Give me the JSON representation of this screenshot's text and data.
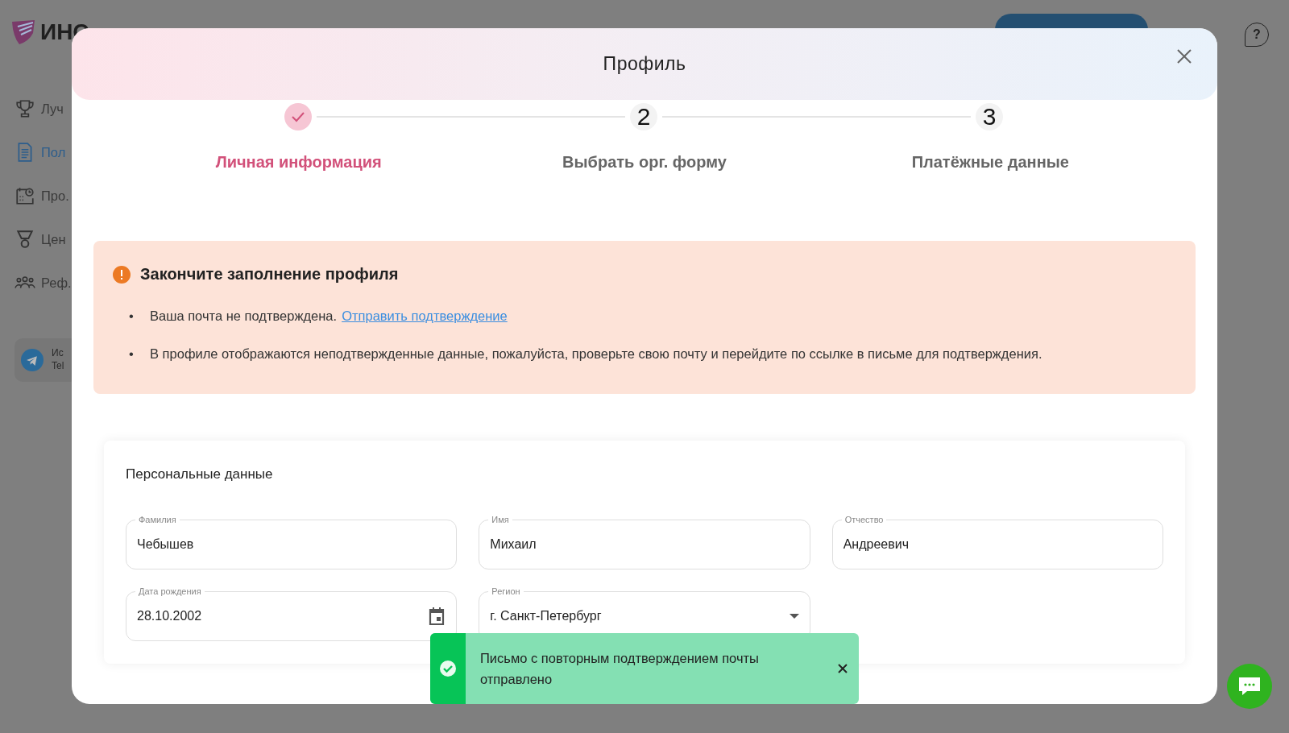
{
  "app": {
    "logo_text": "ИНС",
    "sidebar": [
      {
        "label": "Луч",
        "selected": false
      },
      {
        "label": "Пол",
        "selected": true
      },
      {
        "label": "Про.",
        "selected": false
      },
      {
        "label": "Цен",
        "selected": false
      },
      {
        "label": "Реф.",
        "selected": false
      }
    ],
    "telegram_card": {
      "line_1": "Ис",
      "line_2": "Tel"
    },
    "help_symbol": "?"
  },
  "modal": {
    "title": "Профиль",
    "steps": [
      {
        "label": "Личная информация",
        "completed": true
      },
      {
        "number": "2",
        "label": "Выбрать орг. форму",
        "completed": false
      },
      {
        "number": "3",
        "label": "Платёжные данные",
        "completed": false
      }
    ],
    "alert": {
      "title": "Закончите заполнение профиля",
      "items": [
        {
          "marker": "•",
          "text": "Ваша почта не подтверждена.",
          "link": "Отправить подтверждение"
        },
        {
          "marker": "•",
          "text": "В профиле отображаются неподтвержденные данные, пожалуйста, проверьте свою почту и перейдите по ссылке в письме для подтверждения."
        }
      ]
    },
    "section": {
      "title": "Персональные данные",
      "fields": [
        {
          "label": "Фамилия",
          "value": "Чебышев",
          "kind": "text"
        },
        {
          "label": "Имя",
          "value": "Михаил",
          "kind": "text"
        },
        {
          "label": "Отчество",
          "value": "Андреевич",
          "kind": "text"
        },
        {
          "label": "Дата рождения",
          "value": "28.10.2002",
          "kind": "date"
        },
        {
          "label": "Регион",
          "value": "г. Санкт-Петербург",
          "kind": "select"
        }
      ]
    }
  },
  "toast": {
    "kind": "success",
    "message": "Письмо с повторным подтверждением почты отправлено"
  }
}
